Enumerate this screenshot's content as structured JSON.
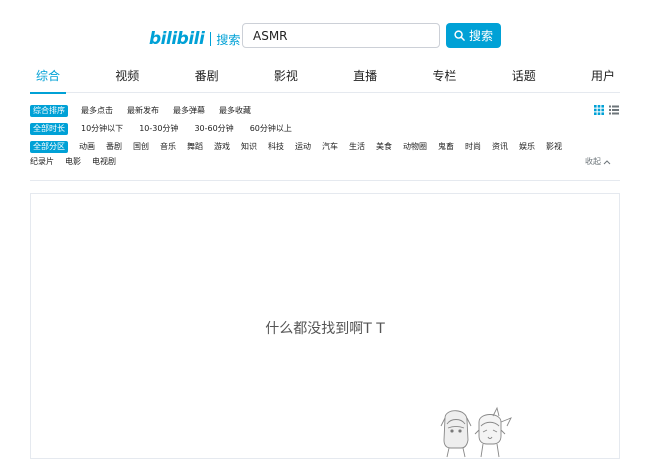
{
  "header": {
    "logo_text": "bilibili",
    "logo_sub": "搜索",
    "search_value": "ASMR",
    "search_button_label": "搜索"
  },
  "nav": {
    "items": [
      "综合",
      "视频",
      "番剧",
      "影视",
      "直播",
      "专栏",
      "话题",
      "用户"
    ],
    "active_index": 0
  },
  "filters": {
    "order": {
      "tag": "综合排序",
      "options": [
        "最多点击",
        "最新发布",
        "最多弹幕",
        "最多收藏"
      ]
    },
    "duration": {
      "tag": "全部时长",
      "options": [
        "10分钟以下",
        "10-30分钟",
        "30-60分钟",
        "60分钟以上"
      ]
    },
    "zone": {
      "tag": "全部分区",
      "options": [
        "动画",
        "番剧",
        "国创",
        "音乐",
        "舞蹈",
        "游戏",
        "知识",
        "科技",
        "运动",
        "汽车",
        "生活",
        "美食",
        "动物圈",
        "鬼畜",
        "时尚",
        "资讯",
        "娱乐",
        "影视"
      ],
      "options_row2": [
        "纪录片",
        "电影",
        "电视剧"
      ],
      "collapse_label": "收起"
    }
  },
  "empty_state": {
    "message": "什么都没找到啊T T"
  },
  "colors": {
    "accent": "#00a1d6",
    "border": "#e5e9ef"
  },
  "icons": {
    "search_button": "search-icon",
    "grid_view": "grid-view-icon",
    "list_view": "list-view-icon",
    "collapse": "chevron-up-icon"
  }
}
